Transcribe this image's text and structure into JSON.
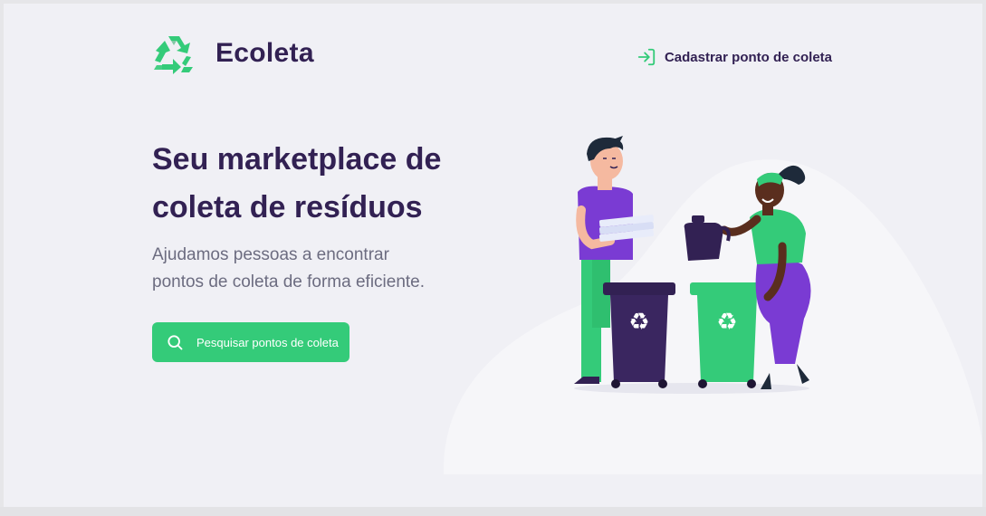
{
  "header": {
    "brand_name": "Ecoleta",
    "logo_icon": "recycle-icon",
    "register_link_label": "Cadastrar ponto de coleta",
    "register_icon": "log-in-icon"
  },
  "hero": {
    "title_line1": "Seu marketplace de",
    "title_line2": "coleta de resíduos",
    "subtitle_line1": "Ajudamos pessoas a encontrar",
    "subtitle_line2": "pontos de coleta de forma eficiente.",
    "search_button_label": "Pesquisar pontos de coleta",
    "search_icon": "search-icon"
  },
  "illustration": {
    "description_icon": "people-recycling-illustration"
  },
  "colors": {
    "primary_green": "#34cb79",
    "title_purple": "#322153",
    "text_gray": "#6c6c80",
    "background": "#f0f0f5",
    "bin_dark": "#322153",
    "shirt_purple": "#7a3bd3"
  }
}
